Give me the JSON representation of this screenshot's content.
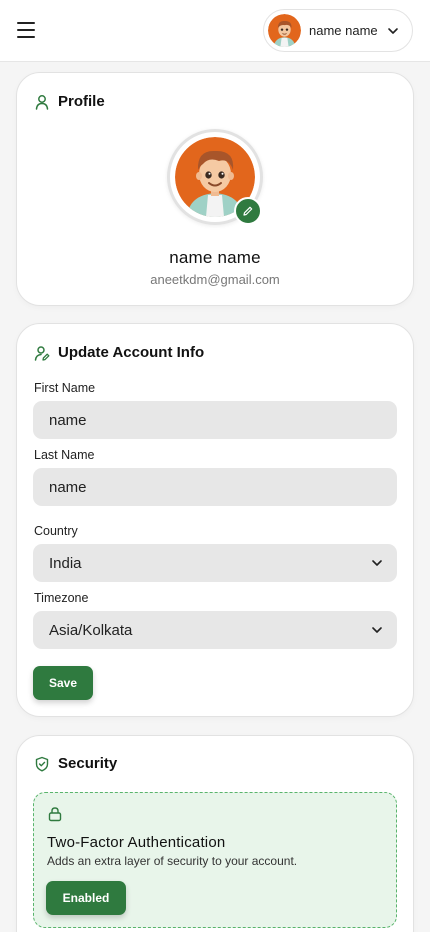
{
  "colors": {
    "accent": "#2f7a3f",
    "tfa_background": "#e8f5ea",
    "tfa_border": "#59b46c",
    "field_background": "#e7e7e7",
    "page_background": "#f5f5f5"
  },
  "header": {
    "menu_icon": "hamburger-icon",
    "user_name": "name name",
    "dropdown_icon": "chevron-down-icon"
  },
  "profile": {
    "title": "Profile",
    "icon": "user-icon",
    "name": "name name",
    "email": "aneetkdm@gmail.com",
    "edit_icon": "pencil-icon"
  },
  "account": {
    "title": "Update Account Info",
    "icon": "user-edit-icon",
    "first_name_label": "First Name",
    "first_name_value": "name",
    "last_name_label": "Last Name",
    "last_name_value": "name",
    "country_label": "Country",
    "country_value": "India",
    "timezone_label": "Timezone",
    "timezone_value": "Asia/Kolkata",
    "save_label": "Save"
  },
  "security": {
    "title": "Security",
    "icon": "shield-check-icon",
    "tfa_icon": "lock-icon",
    "tfa_title": "Two-Factor Authentication",
    "tfa_description": "Adds an extra layer of security to your account.",
    "tfa_button": "Enabled"
  }
}
